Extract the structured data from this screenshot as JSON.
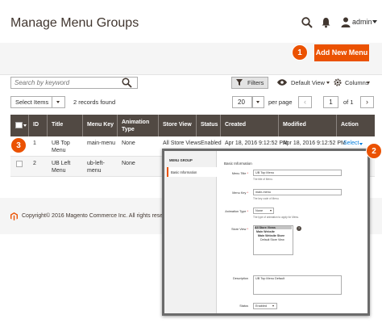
{
  "header": {
    "page_title": "Manage Menu Groups",
    "user_name": "admin"
  },
  "actions": {
    "add_new_label": "Add New Menu",
    "badge_1": "1",
    "badge_2": "2",
    "badge_3": "3"
  },
  "toolbar": {
    "search_placeholder": "Search by keyword",
    "filters_label": "Filters",
    "view_label": "Default View",
    "columns_label": "Columns",
    "select_items_label": "Select Items",
    "records_found": "2 records found",
    "per_page_value": "20",
    "per_page_label": "per page",
    "current_page": "1",
    "of_pages": "of 1",
    "prev_symbol": "‹",
    "next_symbol": "›"
  },
  "table": {
    "columns": [
      "ID",
      "Title",
      "Menu Key",
      "Animation Type",
      "Store View",
      "Status",
      "Created",
      "Modified",
      "Action"
    ],
    "rows": [
      {
        "id": "1",
        "title": "UB Top Menu",
        "key": "main-menu",
        "animation": "None",
        "store": "All Store Views",
        "status": "Enabled",
        "created": "Apr 18, 2016 9:12:52 PM",
        "modified": "Apr 18, 2016 9:12:52 PM",
        "action": "Select"
      },
      {
        "id": "2",
        "title": "UB Left Menu",
        "key": "ub-left-menu",
        "animation": "None",
        "store": "",
        "status": "",
        "created": "",
        "modified": "",
        "action": ""
      }
    ]
  },
  "footer": {
    "copyright": "Copyright© 2016 Magento Commerce Inc. All rights reserved."
  },
  "popup": {
    "sidebar_title": "MENU GROUP",
    "tab_label": "Basic Information",
    "section_title": "Basic Information",
    "fields": {
      "menu_title_label": "Menu Title",
      "menu_title_value": "UB Top Menu",
      "menu_title_note": "The title of Menu.",
      "menu_key_label": "Menu Key",
      "menu_key_value": "main-menu",
      "menu_key_note": "The key code of Menu.",
      "animation_label": "Animation Type",
      "animation_value": "None",
      "animation_note": "The type of animation to apply for Menu.",
      "store_view_label": "Store View",
      "store_options": [
        "All Store Views",
        "Main Website",
        "Main Website Store",
        "Default Store View"
      ],
      "description_label": "Description",
      "description_value": "UB Top Menu Default",
      "status_label": "Status",
      "status_value": "Enabled"
    }
  },
  "colors": {
    "accent": "#eb5202",
    "table_header": "#514943",
    "link": "#007bdb"
  }
}
